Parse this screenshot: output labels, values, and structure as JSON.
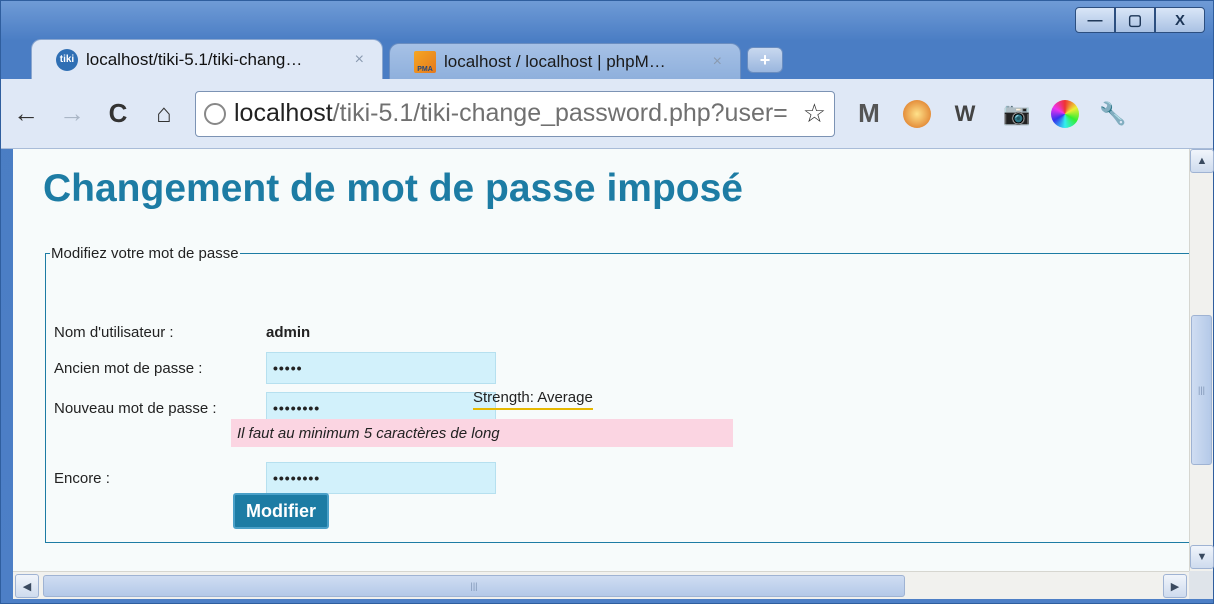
{
  "browser": {
    "tabs": [
      {
        "title": "localhost/tiki-5.1/tiki-chang…",
        "favicon": "tiki-favicon",
        "favicon_text": "tiki"
      },
      {
        "title": "localhost / localhost | phpM…",
        "favicon": "phpmyadmin-favicon",
        "favicon_text": "PMA"
      }
    ],
    "tab_close_glyph": "×",
    "new_tab_glyph": "+",
    "window_controls": {
      "minimize": "—",
      "maximize": "▢",
      "close": "X"
    },
    "nav": {
      "back": "←",
      "forward": "→",
      "reload": "C",
      "home": "⌂"
    },
    "address": {
      "host": "localhost",
      "path": "/tiki-5.1/tiki-change_password.php?user="
    },
    "star_glyph": "☆",
    "extensions": {
      "gmail": "M",
      "wikipedia": "W",
      "camera": "📷",
      "wrench": "🔧"
    }
  },
  "page": {
    "title": "Changement de mot de passe imposé",
    "fieldset_legend": "Modifiez votre mot de passe",
    "username_label": "Nom d'utilisateur :",
    "username_value": "admin",
    "old_password_label": "Ancien mot de passe :",
    "old_password_value": "•••••",
    "new_password_label": "Nouveau mot de passe :",
    "new_password_value": "••••••••",
    "strength_text": "Strength: Average",
    "error_text": "Il faut au minimum 5 caractères de long",
    "confirm_label": "Encore :",
    "confirm_value": "••••••••",
    "submit_label": "Modifier"
  },
  "scrollbars": {
    "up": "▲",
    "down": "▼",
    "left": "◀",
    "right": "▶",
    "grip": "|||"
  },
  "colors": {
    "heading": "#1d7ca4",
    "input_bg": "#d2f1fb",
    "error_bg": "#fbd5e2",
    "strength_underline": "#e6b800"
  }
}
